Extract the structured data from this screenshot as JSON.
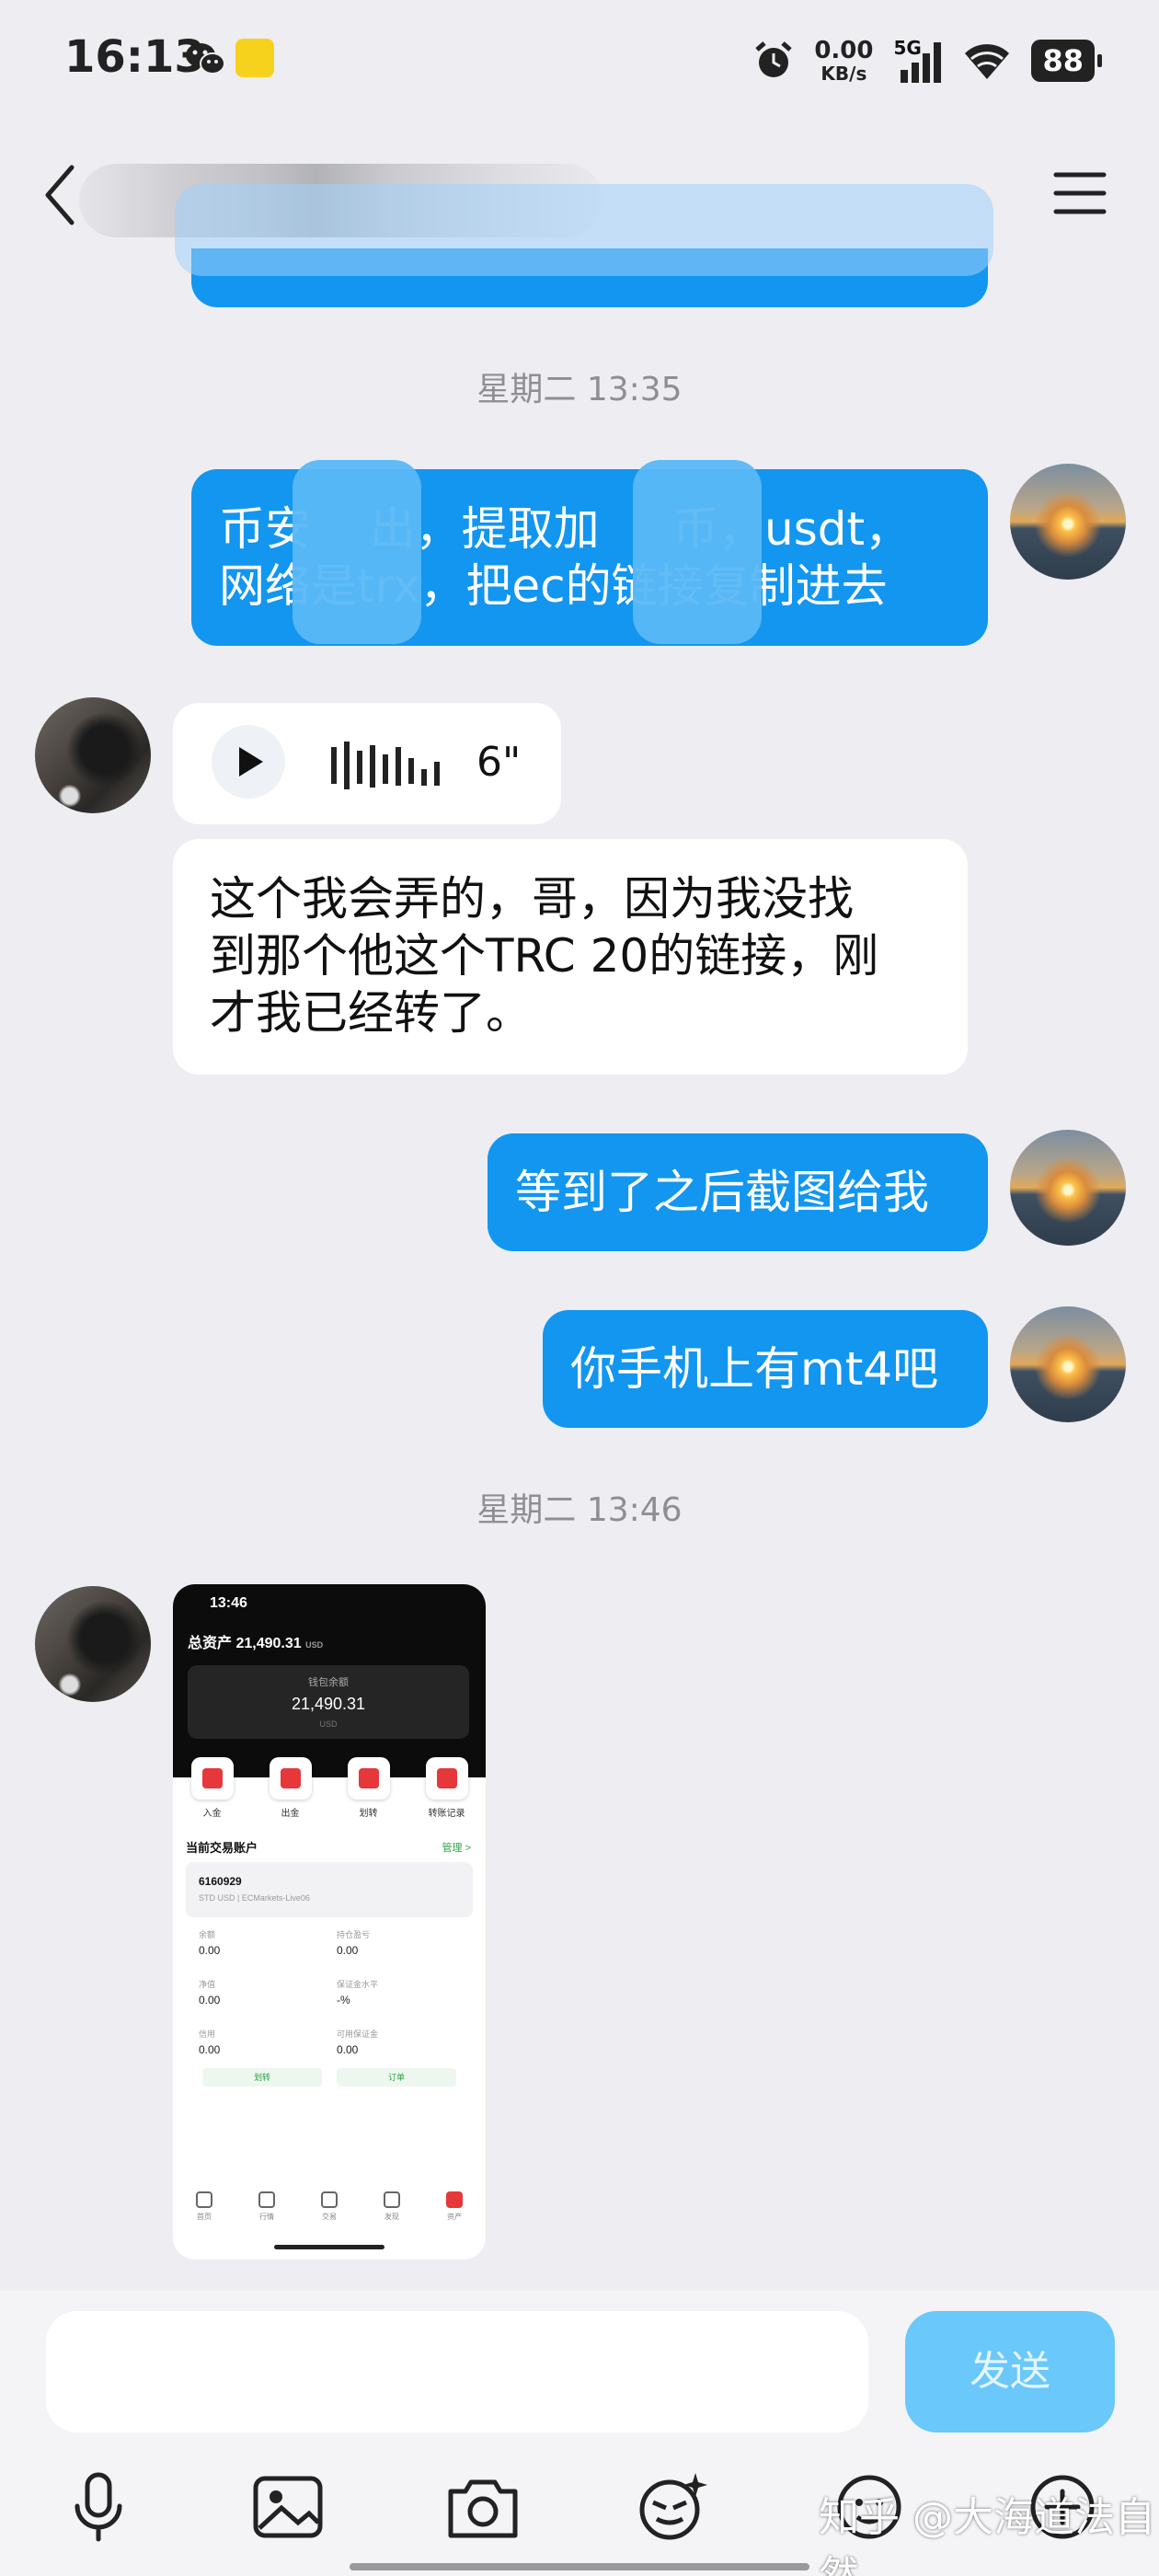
{
  "status_bar": {
    "time": "16:13",
    "net_speed_value": "0.00",
    "net_speed_unit": "KB/s",
    "signal": "5G",
    "battery": "88",
    "icons": [
      "wechat-icon",
      "app-icon",
      "alarm-icon",
      "signal-icon",
      "wifi-icon",
      "battery-icon"
    ]
  },
  "nav": {
    "back_icon": "chevron-left-icon",
    "menu_icon": "hamburger-menu-icon"
  },
  "messages": [
    {
      "type": "timestamp",
      "text": "星期二 13:35"
    },
    {
      "type": "text",
      "sender": "me",
      "text_line1": "币安    出，提取加     币，usdt，",
      "text_line2": "网络是trx，把ec的链接复制进去"
    },
    {
      "type": "voice",
      "sender": "them",
      "duration": "6\""
    },
    {
      "type": "text",
      "sender": "them",
      "text_line1": "这个我会弄的，哥，因为我没找",
      "text_line2": "到那个他这个TRC 20的链接，刚",
      "text_line3": "才我已经转了。"
    },
    {
      "type": "text",
      "sender": "me",
      "text": "等到了之后截图给我"
    },
    {
      "type": "text",
      "sender": "me",
      "text": "你手机上有mt4吧"
    },
    {
      "type": "timestamp",
      "text": "星期二 13:46"
    },
    {
      "type": "image",
      "sender": "them"
    }
  ],
  "screenshot": {
    "time": "13:46",
    "total_label": "总资产",
    "total_value": "21,490.31",
    "total_unit": "USD",
    "wallet_label": "钱包余额",
    "wallet_value": "21,490.31",
    "wallet_unit": "USD",
    "actions": [
      "入金",
      "出金",
      "划转",
      "转账记录"
    ],
    "section_title": "当前交易账户",
    "manage": "管理 >",
    "account_number": "6160929",
    "account_sub": "STD USD | ECMarkets-Live06",
    "fields": [
      {
        "label": "余额",
        "value": "0.00"
      },
      {
        "label": "持仓盈亏",
        "value": "0.00"
      },
      {
        "label": "净值",
        "value": "0.00"
      },
      {
        "label": "保证金水平",
        "value": "-%"
      },
      {
        "label": "信用",
        "value": "0.00"
      },
      {
        "label": "可用保证金",
        "value": "0.00"
      }
    ],
    "button_left": "划转",
    "button_right": "订单",
    "tabs": [
      "首页",
      "行情",
      "交易",
      "发现",
      "资产"
    ]
  },
  "composer": {
    "send_label": "发送",
    "tools": [
      "microphone-icon",
      "image-icon",
      "camera-icon",
      "emoji-icon",
      "sticker-icon",
      "plus-icon"
    ]
  },
  "watermark": "知乎 @大海道法自然"
}
